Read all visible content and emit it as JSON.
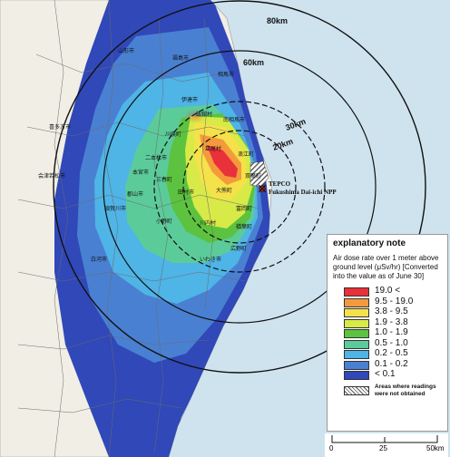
{
  "map": {
    "distance_rings": [
      "80km",
      "60km",
      "30km",
      "20km"
    ],
    "plant": {
      "name": "TEPCO",
      "subname": "Fukushima Dai-ichi NPP"
    },
    "place_labels": [
      "山形市",
      "福島市",
      "伊達市",
      "飯舘村",
      "川俣町",
      "二本松市",
      "本宮市",
      "郡山市",
      "須賀川市",
      "田村市",
      "葛尾村",
      "浪江町",
      "双葉町",
      "大熊町",
      "富岡町",
      "川内村",
      "楢葉町",
      "広野町",
      "いわき市",
      "白河市",
      "会津若松市",
      "喜多方市",
      "相馬市",
      "南相馬市",
      "小野町",
      "三春町"
    ]
  },
  "colors": {
    "sea": "#cfe3ee",
    "land": "#f1eee6",
    "c19": "#e8313a",
    "c95": "#f59a3c",
    "c38": "#f5e24a",
    "c19b": "#d8ea47",
    "c10": "#5cc23f",
    "c05": "#5ccb9a",
    "c02": "#4fb4e6",
    "c01": "#4a80d2",
    "c00": "#3048b8"
  },
  "legend": {
    "title": "explanatory note",
    "description": "Air dose rate over 1 meter above ground level (μSv/hr) [Converted into the value as of June 30]",
    "ranges": [
      {
        "label": "19.0  <",
        "color": "#e8313a"
      },
      {
        "label": "9.5 - 19.0",
        "color": "#f59a3c"
      },
      {
        "label": "3.8 - 9.5",
        "color": "#f5e24a"
      },
      {
        "label": "1.9 - 3.8",
        "color": "#d8ea47"
      },
      {
        "label": "1.0 - 1.9",
        "color": "#5cc23f"
      },
      {
        "label": "0.5 - 1.0",
        "color": "#5ccb9a"
      },
      {
        "label": "0.2 - 0.5",
        "color": "#4fb4e6"
      },
      {
        "label": "0.1 - 0.2",
        "color": "#4a80d2"
      },
      {
        "label": "< 0.1",
        "color": "#3048b8"
      }
    ],
    "na_label": "Areas where readings were not obtained"
  },
  "scale": {
    "ticks": [
      "0",
      "25",
      "50km"
    ]
  }
}
